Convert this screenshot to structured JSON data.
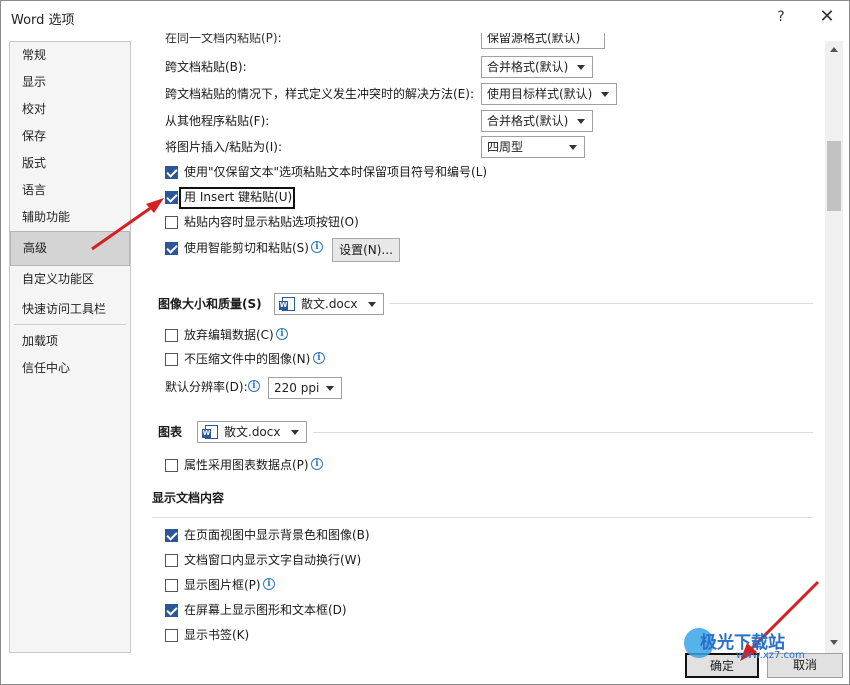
{
  "window": {
    "title": "Word 选项",
    "help_label": "?",
    "close_label": "✕"
  },
  "sidebar": {
    "items": [
      {
        "label": "常规"
      },
      {
        "label": "显示"
      },
      {
        "label": "校对"
      },
      {
        "label": "保存"
      },
      {
        "label": "版式"
      },
      {
        "label": "语言"
      },
      {
        "label": "辅助功能"
      },
      {
        "label": "高级",
        "active": true
      },
      {
        "label": "自定义功能区"
      },
      {
        "label": "快速访问工具栏"
      },
      {
        "label": "加载项"
      },
      {
        "label": "信任中心"
      }
    ]
  },
  "paste_options": {
    "partial_top": {
      "label": "在同一文档内粘贴(P):",
      "value": "保留源格式(默认)"
    },
    "cross_doc": {
      "label": "跨文档粘贴(B):",
      "value": "合并格式(默认)"
    },
    "cross_doc_conflict": {
      "label": "跨文档粘贴的情况下，样式定义发生冲突时的解决方法(E):",
      "value": "使用目标样式(默认)"
    },
    "other_program": {
      "label": "从其他程序粘贴(F):",
      "value": "合并格式(默认)"
    },
    "insert_picture": {
      "label": "将图片插入/粘贴为(I):",
      "value": "四周型"
    },
    "keep_bullets": {
      "label": "使用\"仅保留文本\"选项粘贴文本时保留项目符号和编号(L)",
      "checked": true
    },
    "insert_key": {
      "label": "用 Insert 键粘贴(U)",
      "checked": true
    },
    "show_paste_button": {
      "label": "粘贴内容时显示粘贴选项按钮(O)",
      "checked": false
    },
    "smart_cut": {
      "label": "使用智能剪切和粘贴(S)",
      "checked": true
    },
    "settings_button": "设置(N)..."
  },
  "image_quality": {
    "title": "图像大小和质量(S)",
    "document": "散文.docx",
    "discard_edit": {
      "label": "放弃编辑数据(C)",
      "checked": false
    },
    "no_compress": {
      "label": "不压缩文件中的图像(N)",
      "checked": false
    },
    "resolution": {
      "label": "默认分辨率(D):",
      "value": "220 ppi"
    }
  },
  "chart": {
    "title": "图表",
    "document": "散文.docx",
    "properties_follow": {
      "label": "属性采用图表数据点(P)",
      "checked": false
    }
  },
  "display_content": {
    "title": "显示文档内容",
    "bg_colors": {
      "label": "在页面视图中显示背景色和图像(B)",
      "checked": true
    },
    "wrap_text": {
      "label": "文档窗口内显示文字自动换行(W)",
      "checked": false
    },
    "picture_placeholders": {
      "label": "显示图片框(P)",
      "checked": false
    },
    "drawings": {
      "label": "在屏幕上显示图形和文本框(D)",
      "checked": true
    },
    "bookmarks": {
      "label": "显示书签(K)",
      "checked": false
    }
  },
  "footer": {
    "ok": "确定",
    "cancel": "取消"
  },
  "watermark": {
    "brand": "极光下载站",
    "url": "www.xz7.com"
  },
  "colors": {
    "accent": "#2b579a",
    "arrow": "#d42020",
    "info": "#2b79c2"
  }
}
